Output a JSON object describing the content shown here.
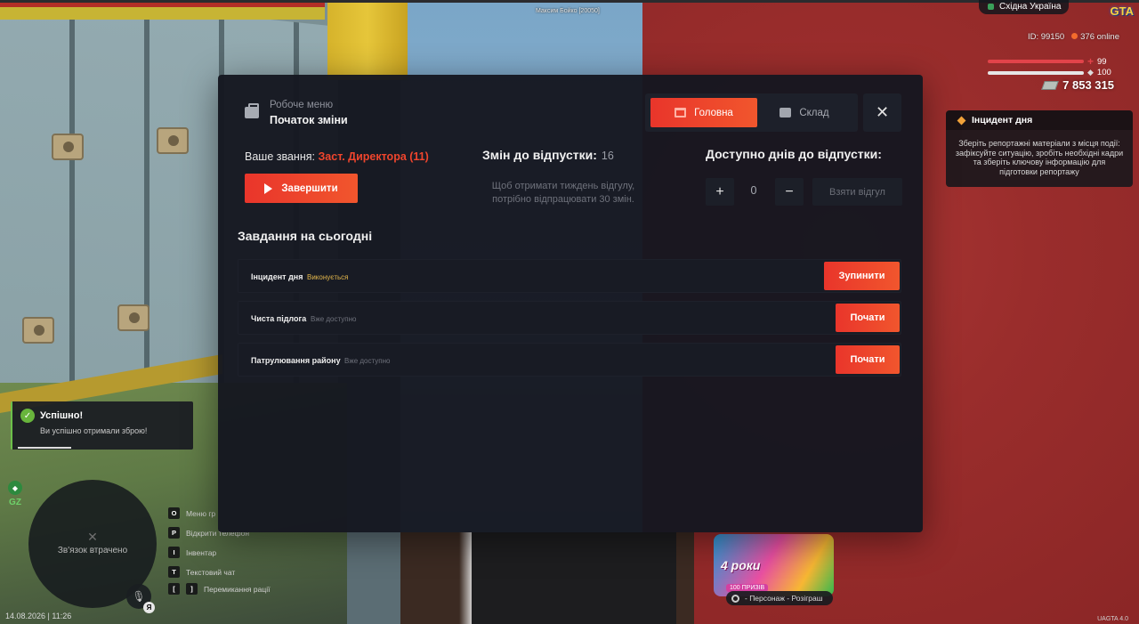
{
  "hud": {
    "player_tag": "Максим Бойко [20050]",
    "region": "Східна Україна",
    "logo": "GTA",
    "id_label": "ID: 99150",
    "online_label": "376 online",
    "health": "99",
    "armor": "100",
    "money": "7 853 315",
    "datetime": "14.08.2026 | 11:26",
    "version": "UAGTA 4.0",
    "gz": "GZ",
    "voice_key": "Я",
    "health_color": "#e2434a",
    "armor_color": "#e6e6e6"
  },
  "incident_card": {
    "title": "Інцидент дня",
    "text": "Зберіть репортажні матеріали з місця події: зафіксуйте ситуацію, зробіть необхідні кадри та зберіть ключову інформацію для підготовки репортажу"
  },
  "notification": {
    "title": "Успішно!",
    "text": "Ви успішно отримали зброю!"
  },
  "minimap": {
    "status": "Зв'язок втрачено"
  },
  "hints": [
    {
      "key": "O",
      "label": "Меню гр"
    },
    {
      "key": "P",
      "label": "Відкрити телефон"
    },
    {
      "key": "I",
      "label": "Інвентар"
    },
    {
      "key": "T",
      "label": "Текстовий чат"
    },
    {
      "key": "[",
      "key2": "]",
      "label": "Перемикання рації"
    }
  ],
  "promo": {
    "title": "4 роки",
    "subtitle": "100 ПРИЗІВ",
    "bar": "- Персонаж - Розіграш"
  },
  "modal": {
    "subtitle": "Робоче меню",
    "title": "Початок зміни",
    "tabs": {
      "main": "Головна",
      "stock": "Склад"
    },
    "close_icon": "close-icon",
    "rank_label": "Ваше звання:",
    "rank_value": "Заст. Директора (11)",
    "finish_label": "Завершити",
    "shifts_label": "Змін до відпустки:",
    "shifts_value": "16",
    "shifts_note": "Щоб отримати тиждень відгулу, потрібно відпрацювати 30 змін.",
    "days_title": "Доступно днів до відпустки:",
    "days_value": "0",
    "plus": "+",
    "minus": "−",
    "take_label": "Взяти відгул",
    "tasks_title": "Завдання на сьогодні",
    "tasks": [
      {
        "name": "Інцидент дня",
        "status": "Виконується",
        "action": "Зупинити"
      },
      {
        "name": "Чиста підлога",
        "status": "Вже доступно",
        "action": "Почати"
      },
      {
        "name": "Патрулювання району",
        "status": "Вже доступно",
        "action": "Почати"
      }
    ],
    "accent_color": "#ee442c"
  }
}
